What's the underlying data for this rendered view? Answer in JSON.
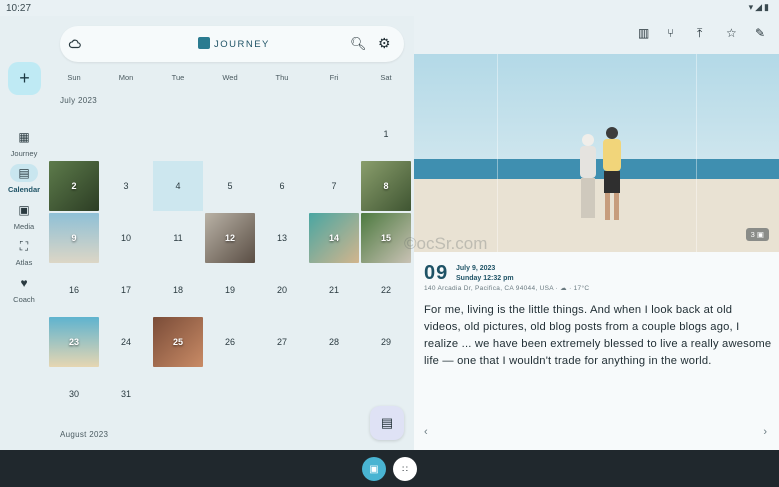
{
  "status": {
    "time": "10:27",
    "icons": "▾◢▮"
  },
  "header": {
    "brand": "JOURNEY"
  },
  "rail": {
    "add_label": "+",
    "items": [
      {
        "label": "Journey",
        "icon": "▦"
      },
      {
        "label": "Calendar",
        "icon": "▤"
      },
      {
        "label": "Media",
        "icon": "▣"
      },
      {
        "label": "Atlas",
        "icon": "⛶"
      },
      {
        "label": "Coach",
        "icon": "♥"
      }
    ]
  },
  "calendar": {
    "weekdays": [
      "Sun",
      "Mon",
      "Tue",
      "Wed",
      "Thu",
      "Fri",
      "Sat"
    ],
    "month_current": "July 2023",
    "month_next": "August 2023",
    "days": [
      "1",
      "2",
      "3",
      "4",
      "5",
      "6",
      "7",
      "8",
      "9",
      "10",
      "11",
      "12",
      "13",
      "14",
      "15",
      "16",
      "17",
      "18",
      "19",
      "20",
      "21",
      "22",
      "23",
      "24",
      "25",
      "26",
      "27",
      "28",
      "29",
      "30",
      "31"
    ],
    "today": "4",
    "photo_days": [
      "2",
      "8",
      "9",
      "12",
      "14",
      "15",
      "23",
      "25"
    ]
  },
  "entry": {
    "day": "09",
    "date_line": "July 9, 2023",
    "time_line": "Sunday 12:32 pm",
    "location": "140 Arcadia Dr, Pacifica, CA 94044, USA · ☁ · 17°C",
    "photo_count": "3",
    "body": "For me, living is the little things. And when I look back at old videos, old pictures, old blog posts from a couple blogs ago, I realize ... we have been extremely blessed to live a really awesome life — one that I wouldn't trade for anything in the world.",
    "watermark": "©ocSr.com"
  },
  "colors": {
    "accent": "#1f5366",
    "fab": "#bfeaf4",
    "today": "#cde7ef"
  }
}
